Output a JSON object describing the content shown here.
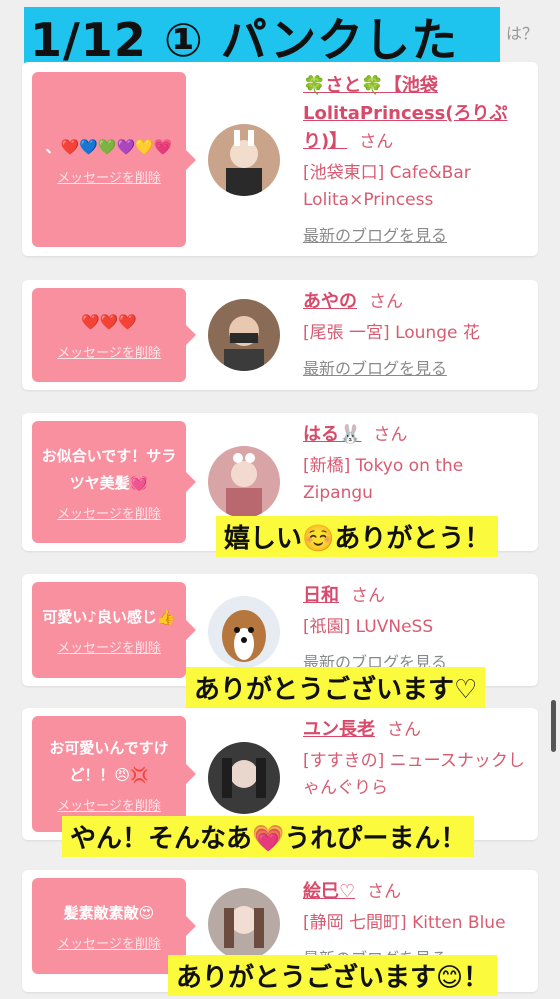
{
  "top_hint": "は？",
  "title": "1/12 ① パンクした",
  "delete_label": "メッセージを削除",
  "blog_label": "最新のブログを見る",
  "san": "さん",
  "cards": [
    {
      "message": "、❤️💙💚💜💛💗",
      "name": "🍀さと🍀【池袋LolitaPrincess(ろりぷり)】",
      "shop": "[池袋東口] Cafe&Bar Lolita×Princess",
      "show_blog": true
    },
    {
      "message": "❤️❤️❤️",
      "name": "あやの",
      "shop": "[尾張 一宮] Lounge 花",
      "show_blog": true
    },
    {
      "message": "お似合いです！サラツヤ美髪💓",
      "name": "はる🐰",
      "shop": "[新橋] Tokyo on the Zipangu",
      "show_blog": false
    },
    {
      "message": "可愛い♪良い感じ👍",
      "name": "日和",
      "shop": "[祇園] LUVNeSS",
      "show_blog": true
    },
    {
      "message": "お可愛いんですけど！！😠💢",
      "name": "ユン長老",
      "shop": "[すすきの] ニュースナックしゃんぐりら",
      "show_blog": false
    },
    {
      "message": "髪素敵素敵😍",
      "name": "絵巳♡",
      "shop": "[静岡 七間町] Kitten Blue",
      "show_blog": true
    }
  ],
  "overlays": {
    "reply1": "嬉しい☺️ありがとう！",
    "reply2": "ありがとうございます♡",
    "reply3": "やん！そんなあ💗うれぴーまん！",
    "reply4": "ありがとうございます😊！"
  },
  "colors": {
    "bubble": "#f9909f",
    "name": "#d84a6a",
    "banner": "#1ec3ee",
    "highlight": "#fcfa3c"
  }
}
